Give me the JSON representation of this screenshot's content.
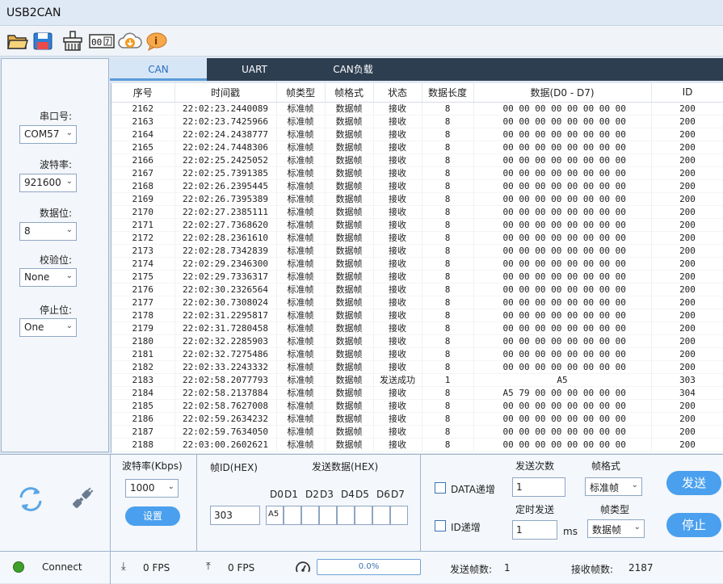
{
  "window": {
    "title": "USB2CAN"
  },
  "toolbar": {
    "icons": [
      "open-folder-icon",
      "save-icon",
      "clear-icon",
      "counter-icon",
      "download-cloud-icon",
      "info-icon"
    ],
    "counter_text": "00"
  },
  "serial": {
    "port_label": "串口号:",
    "port_value": "COM57",
    "baud_label": "波特率:",
    "baud_value": "921600",
    "databits_label": "数据位:",
    "databits_value": "8",
    "parity_label": "校验位:",
    "parity_value": "None",
    "stopbits_label": "停止位:",
    "stopbits_value": "One"
  },
  "tabs": [
    "CAN",
    "UART",
    "CAN负载"
  ],
  "table": {
    "headers": [
      "序号",
      "时间戳",
      "帧类型",
      "帧格式",
      "状态",
      "数据长度",
      "数据(D0 - D7)",
      "ID"
    ],
    "rows": [
      [
        "2162",
        "22:02:23.2440089",
        "标准帧",
        "数据帧",
        "接收",
        "8",
        "00 00 00 00 00 00 00 00",
        "200"
      ],
      [
        "2163",
        "22:02:23.7425966",
        "标准帧",
        "数据帧",
        "接收",
        "8",
        "00 00 00 00 00 00 00 00",
        "200"
      ],
      [
        "2164",
        "22:02:24.2438777",
        "标准帧",
        "数据帧",
        "接收",
        "8",
        "00 00 00 00 00 00 00 00",
        "200"
      ],
      [
        "2165",
        "22:02:24.7448306",
        "标准帧",
        "数据帧",
        "接收",
        "8",
        "00 00 00 00 00 00 00 00",
        "200"
      ],
      [
        "2166",
        "22:02:25.2425052",
        "标准帧",
        "数据帧",
        "接收",
        "8",
        "00 00 00 00 00 00 00 00",
        "200"
      ],
      [
        "2167",
        "22:02:25.7391385",
        "标准帧",
        "数据帧",
        "接收",
        "8",
        "00 00 00 00 00 00 00 00",
        "200"
      ],
      [
        "2168",
        "22:02:26.2395445",
        "标准帧",
        "数据帧",
        "接收",
        "8",
        "00 00 00 00 00 00 00 00",
        "200"
      ],
      [
        "2169",
        "22:02:26.7395389",
        "标准帧",
        "数据帧",
        "接收",
        "8",
        "00 00 00 00 00 00 00 00",
        "200"
      ],
      [
        "2170",
        "22:02:27.2385111",
        "标准帧",
        "数据帧",
        "接收",
        "8",
        "00 00 00 00 00 00 00 00",
        "200"
      ],
      [
        "2171",
        "22:02:27.7368620",
        "标准帧",
        "数据帧",
        "接收",
        "8",
        "00 00 00 00 00 00 00 00",
        "200"
      ],
      [
        "2172",
        "22:02:28.2361610",
        "标准帧",
        "数据帧",
        "接收",
        "8",
        "00 00 00 00 00 00 00 00",
        "200"
      ],
      [
        "2173",
        "22:02:28.7342839",
        "标准帧",
        "数据帧",
        "接收",
        "8",
        "00 00 00 00 00 00 00 00",
        "200"
      ],
      [
        "2174",
        "22:02:29.2346300",
        "标准帧",
        "数据帧",
        "接收",
        "8",
        "00 00 00 00 00 00 00 00",
        "200"
      ],
      [
        "2175",
        "22:02:29.7336317",
        "标准帧",
        "数据帧",
        "接收",
        "8",
        "00 00 00 00 00 00 00 00",
        "200"
      ],
      [
        "2176",
        "22:02:30.2326564",
        "标准帧",
        "数据帧",
        "接收",
        "8",
        "00 00 00 00 00 00 00 00",
        "200"
      ],
      [
        "2177",
        "22:02:30.7308024",
        "标准帧",
        "数据帧",
        "接收",
        "8",
        "00 00 00 00 00 00 00 00",
        "200"
      ],
      [
        "2178",
        "22:02:31.2295817",
        "标准帧",
        "数据帧",
        "接收",
        "8",
        "00 00 00 00 00 00 00 00",
        "200"
      ],
      [
        "2179",
        "22:02:31.7280458",
        "标准帧",
        "数据帧",
        "接收",
        "8",
        "00 00 00 00 00 00 00 00",
        "200"
      ],
      [
        "2180",
        "22:02:32.2285903",
        "标准帧",
        "数据帧",
        "接收",
        "8",
        "00 00 00 00 00 00 00 00",
        "200"
      ],
      [
        "2181",
        "22:02:32.7275486",
        "标准帧",
        "数据帧",
        "接收",
        "8",
        "00 00 00 00 00 00 00 00",
        "200"
      ],
      [
        "2182",
        "22:02:33.2243332",
        "标准帧",
        "数据帧",
        "接收",
        "8",
        "00 00 00 00 00 00 00 00",
        "200"
      ],
      [
        "2183",
        "22:02:58.2077793",
        "标准帧",
        "数据帧",
        "发送成功",
        "1",
        "A5",
        "303"
      ],
      [
        "2184",
        "22:02:58.2137884",
        "标准帧",
        "数据帧",
        "接收",
        "8",
        "A5 79 00 00 00 00 00 00",
        "304"
      ],
      [
        "2185",
        "22:02:58.7627008",
        "标准帧",
        "数据帧",
        "接收",
        "8",
        "00 00 00 00 00 00 00 00",
        "200"
      ],
      [
        "2186",
        "22:02:59.2634232",
        "标准帧",
        "数据帧",
        "接收",
        "8",
        "00 00 00 00 00 00 00 00",
        "200"
      ],
      [
        "2187",
        "22:02:59.7634050",
        "标准帧",
        "数据帧",
        "接收",
        "8",
        "00 00 00 00 00 00 00 00",
        "200"
      ],
      [
        "2188",
        "22:03:00.2602621",
        "标准帧",
        "数据帧",
        "接收",
        "8",
        "00 00 00 00 00 00 00 00",
        "200"
      ]
    ]
  },
  "can_cfg": {
    "baud_label": "波特率(Kbps)",
    "baud_value": "1000",
    "set_button": "设置"
  },
  "send": {
    "id_label": "帧ID(HEX)",
    "data_label": "发送数据(HEX)",
    "id_value": "303",
    "byte_labels": [
      "D0",
      "D1",
      "D2",
      "D3",
      "D4",
      "D5",
      "D6",
      "D7"
    ],
    "byte_values": [
      "A5",
      "",
      "",
      "",
      "",
      "",
      "",
      ""
    ]
  },
  "options": {
    "data_inc_label": "DATA递增",
    "id_inc_label": "ID递增",
    "count_label": "发送次数",
    "count_value": "1",
    "timer_label": "定时发送",
    "timer_value": "1",
    "timer_unit": "ms",
    "format_label": "帧格式",
    "format_value": "标准帧",
    "type_label": "帧类型",
    "type_value": "数据帧",
    "send_button": "发送",
    "stop_button": "停止"
  },
  "status": {
    "connect_label": "Connect",
    "connect_color": "#3ea02a",
    "rx_fps": "0 FPS",
    "tx_fps": "0 FPS",
    "progress_text": "0.0%",
    "progress": 0,
    "sent_label": "发送帧数:",
    "sent_value": "1",
    "recv_label": "接收帧数:",
    "recv_value": "2187"
  }
}
